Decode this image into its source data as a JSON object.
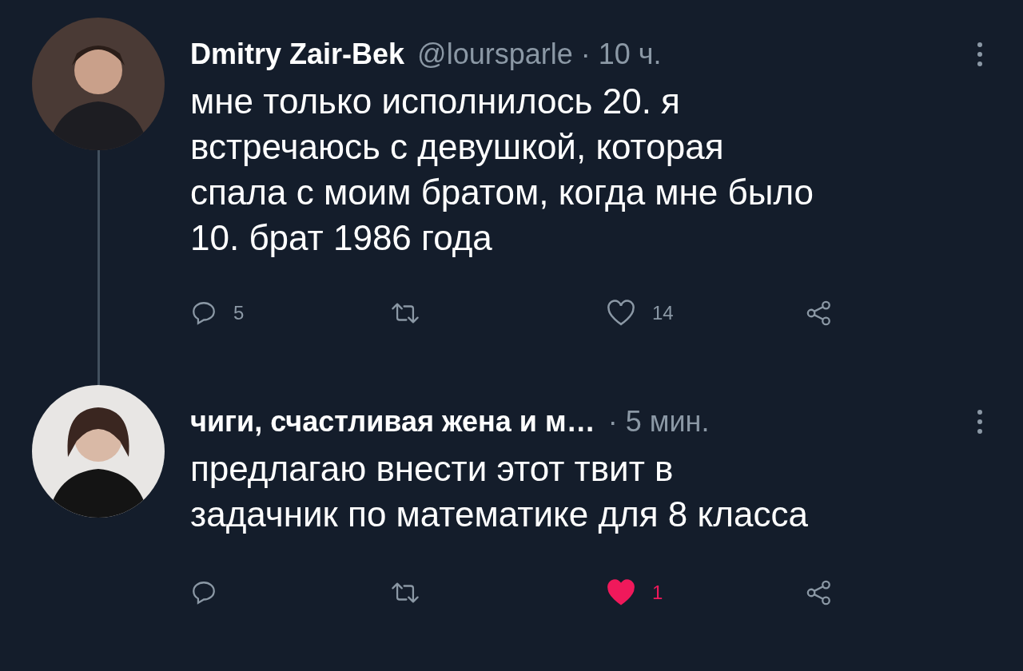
{
  "tweets": [
    {
      "name": "Dmitry Zair-Bek",
      "meta": "@loursparle · 10 ч.",
      "text": "мне только исполнилось 20. я\nвстречаюсь с девушкой, которая\nспала с моим братом, когда мне было\n10. брат 1986 года",
      "reply_count": "5",
      "like_count": "14",
      "liked": false
    },
    {
      "name": "чиги, счастливая жена и м…",
      "meta": "· 5 мин.",
      "text": "предлагаю внести этот твит в\nзадачник по математике для 8 класса",
      "like_count": "1",
      "liked": true
    }
  ]
}
